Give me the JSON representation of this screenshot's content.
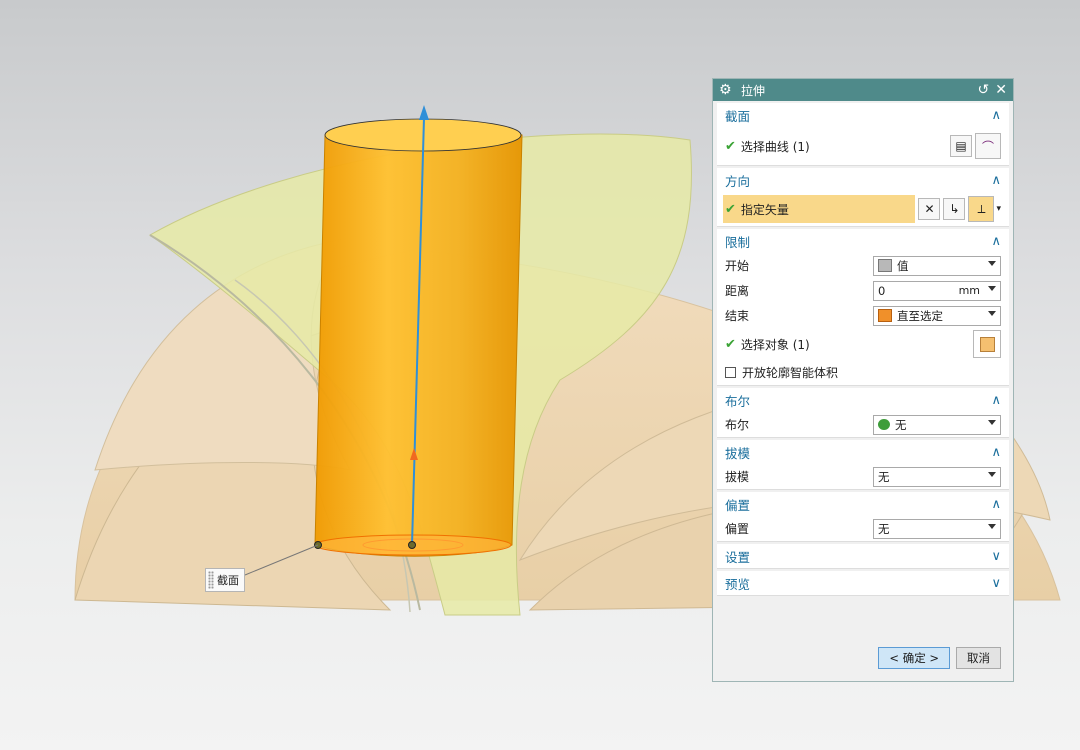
{
  "dialog": {
    "title": "拉伸",
    "sections": {
      "section": {
        "label": "截面",
        "select_curve": "选择曲线 (1)"
      },
      "direction": {
        "label": "方向",
        "specify_vector": "指定矢量"
      },
      "limits": {
        "label": "限制",
        "start_label": "开始",
        "start_value": "值",
        "distance_label": "距离",
        "distance_value": "0",
        "distance_unit": "mm",
        "end_label": "结束",
        "end_value": "直至选定",
        "select_object": "选择对象 (1)",
        "open_profile": "开放轮廓智能体积"
      },
      "boolean": {
        "label": "布尔",
        "row_label": "布尔",
        "value": "无"
      },
      "draft": {
        "label": "拔模",
        "row_label": "拔模",
        "value": "无"
      },
      "offset": {
        "label": "偏置",
        "row_label": "偏置",
        "value": "无"
      },
      "settings": {
        "label": "设置"
      },
      "preview": {
        "label": "预览"
      }
    },
    "buttons": {
      "ok": "< 确定 >",
      "cancel": "取消"
    }
  },
  "viewport": {
    "callout_label": "截面"
  },
  "colors": {
    "title_bar": "#4f8a8a",
    "section_header": "#1a6e9c",
    "extrude": "#f5a800",
    "dome": "#efd9b8",
    "sheet": "#e6eaa6",
    "vector": "#2f8fd8"
  }
}
